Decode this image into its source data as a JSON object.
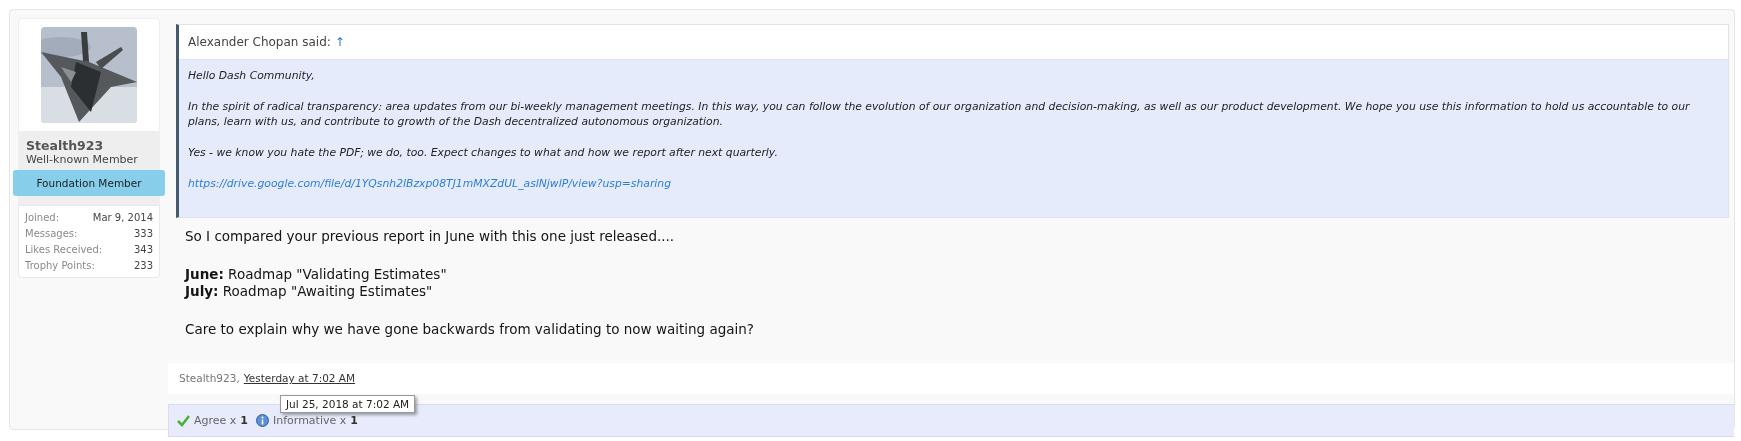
{
  "user": {
    "name": "Stealth923",
    "title": "Well-known Member",
    "banner": "Foundation Member",
    "stats": [
      {
        "label": "Joined:",
        "value": "Mar 9, 2014"
      },
      {
        "label": "Messages:",
        "value": "333"
      },
      {
        "label": "Likes Received:",
        "value": "343"
      },
      {
        "label": "Trophy Points:",
        "value": "233"
      }
    ]
  },
  "quote": {
    "author": "Alexander Chopan said:",
    "jump": "↑",
    "paragraphs": [
      "Hello Dash Community,",
      "In the spirit of radical transparency: area updates from our bi-weekly management meetings. In this way, you can follow the evolution of our organization and decision-making, as well as our product development. We hope you use this information to hold us accountable to our plans, learn with us, and contribute to growth of the Dash decentralized autonomous organization.",
      "Yes - we know you hate the PDF; we do, too. Expect changes to what and how we report after next quarterly."
    ],
    "link": "https://drive.google.com/file/d/1YQsnh2lBzxp08TJ1mMXZdUL_aslNjwlP/view?usp=sharing"
  },
  "message": {
    "paragraphs": [
      [
        "So I compared your previous report in June with this one just released...."
      ],
      [
        "**June:** Roadmap \"Validating Estimates\"",
        "**July:** Roadmap \"Awaiting Estimates\""
      ],
      [
        "Care to explain why we have gone backwards from validating to now waiting again?"
      ]
    ]
  },
  "signature": {
    "author": "Stealth923,",
    "time": "Yesterday at 7:02 AM"
  },
  "tooltip": "Jul 25, 2018 at 7:02 AM",
  "reactions": [
    {
      "kind": "agree",
      "label": "Agree x",
      "count": "1"
    },
    {
      "kind": "informative",
      "label": "Informative x",
      "count": "1"
    }
  ]
}
